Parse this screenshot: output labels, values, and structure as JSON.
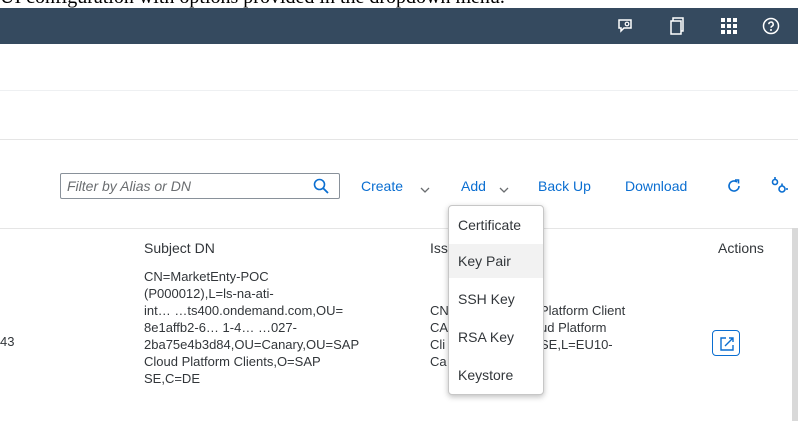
{
  "caption": {
    "text": "UI configuration with options provided in the dropdown menu."
  },
  "shellbar": {
    "icons": [
      "chat-feedback-icon",
      "copy-icon",
      "product-switch-icon",
      "help-icon"
    ]
  },
  "toolbar": {
    "search_placeholder": "Filter by Alias or DN",
    "create_label": "Create",
    "add_label": "Add",
    "backup_label": "Back Up",
    "download_label": "Download"
  },
  "table": {
    "headers": {
      "subject": "Subject DN",
      "issuer": "Iss",
      "actions": "Actions"
    },
    "row": {
      "num": "43",
      "subject_lines": [
        "CN=MarketEnty-POC",
        "(P000012),L=ls-na-ati-",
        "int…    …ts400.ondemand.com,OU=",
        "8e1affb2-6… 1-4…  …027-",
        "2ba75e4b3d84,OU=Canary,OU=SAP",
        "Cloud Platform Clients,O=SAP",
        "SE,C=DE"
      ],
      "issuer_left_lines": [
        "CN",
        "CA",
        "Cli",
        "Ca"
      ],
      "issuer_right_lines": [
        "Platform Client",
        "ud Platform",
        "SE,L=EU10-"
      ]
    }
  },
  "add_menu": {
    "items": [
      "Certificate",
      "Key Pair",
      "SSH Key",
      "RSA Key",
      "Keystore"
    ],
    "highlighted_index": 1
  },
  "colors": {
    "shellbar": "#354a5f",
    "accent": "#0a6ed1",
    "text": "#32363a"
  }
}
